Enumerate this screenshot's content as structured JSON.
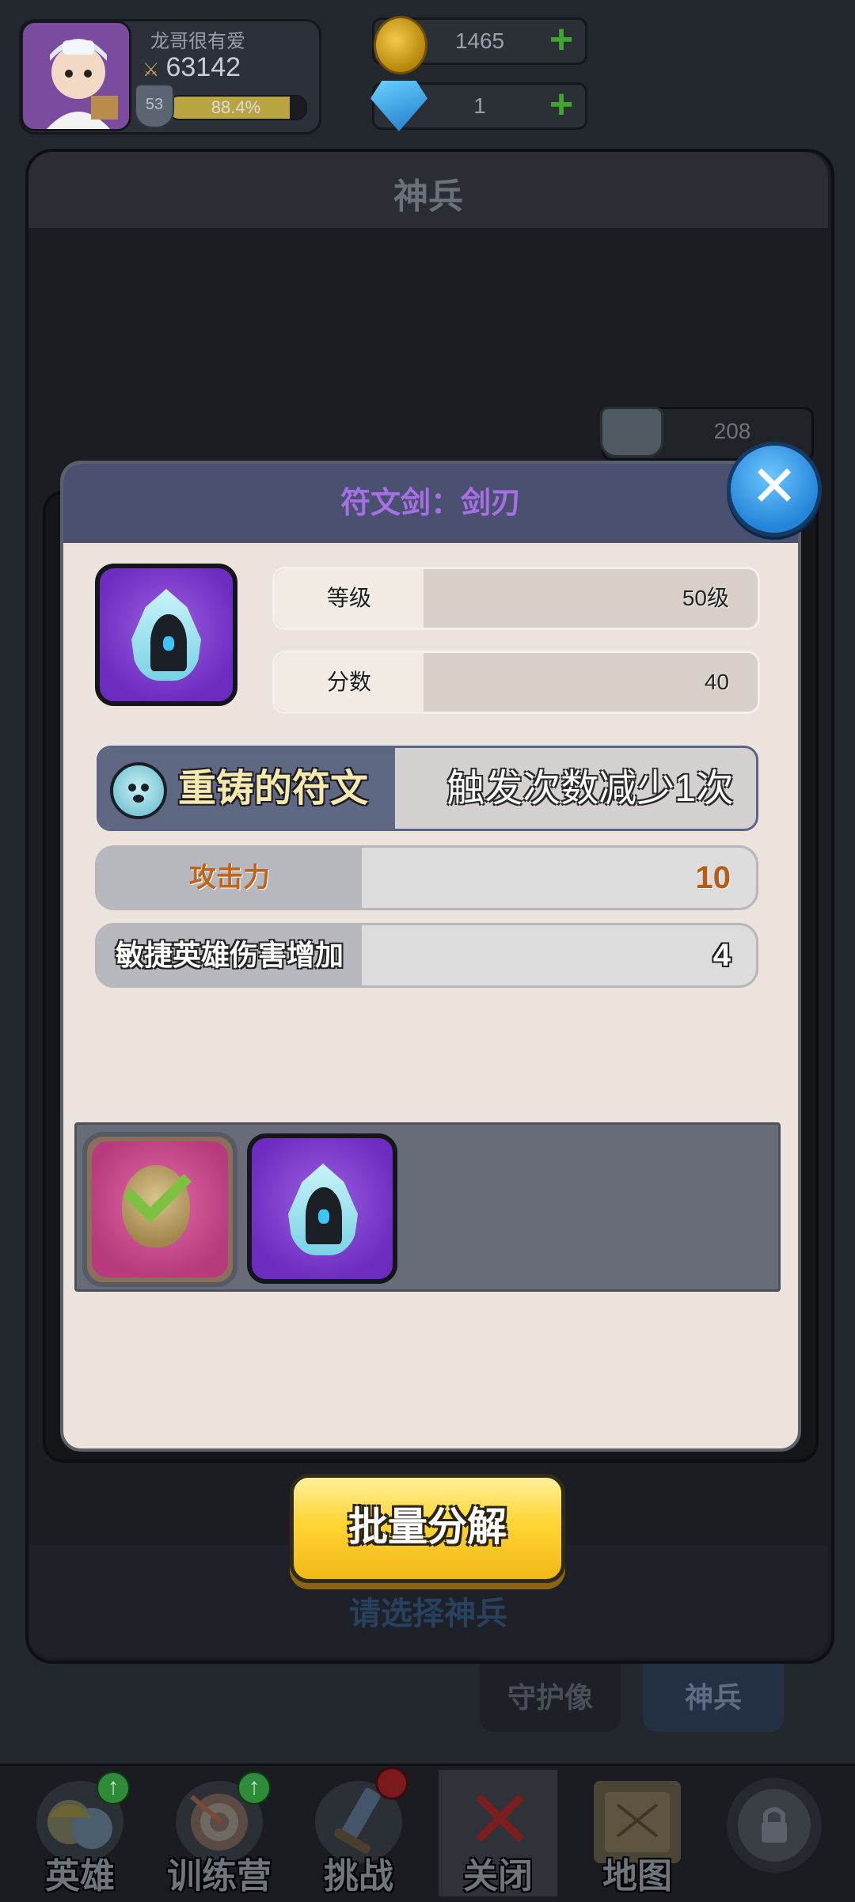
{
  "player": {
    "name": "龙哥很有爱",
    "power": "63142",
    "level": "53",
    "xp_percent_text": "88.4%",
    "xp_fraction": 0.884
  },
  "currencies": {
    "gold": "1465",
    "diamond": "1"
  },
  "background_panel": {
    "title": "神兵",
    "stone_count": "208",
    "hint": "请选择神兵",
    "tabs": [
      "守护像",
      "神兵"
    ]
  },
  "modal": {
    "title": "符文剑：剑刃",
    "stats": [
      {
        "label": "等级",
        "value": "50级"
      },
      {
        "label": "分数",
        "value": "40"
      }
    ],
    "rune": {
      "name": "重铸的符文",
      "effect": "触发次数减少1次"
    },
    "attributes": [
      {
        "label": "攻击力",
        "value": "10"
      },
      {
        "label": "敏捷英雄伤害增加",
        "value": "4"
      }
    ],
    "close_icon": "close-icon"
  },
  "action_button": {
    "label": "批量分解"
  },
  "bottom_nav": [
    {
      "label": "英雄"
    },
    {
      "label": "训练营"
    },
    {
      "label": "挑战"
    },
    {
      "label": "关闭"
    },
    {
      "label": "地图"
    }
  ],
  "colors": {
    "modal_header": "#4a5170",
    "modal_title": "#a86ee6",
    "action_button": "#ffd534",
    "close_button": "#2484d8"
  }
}
